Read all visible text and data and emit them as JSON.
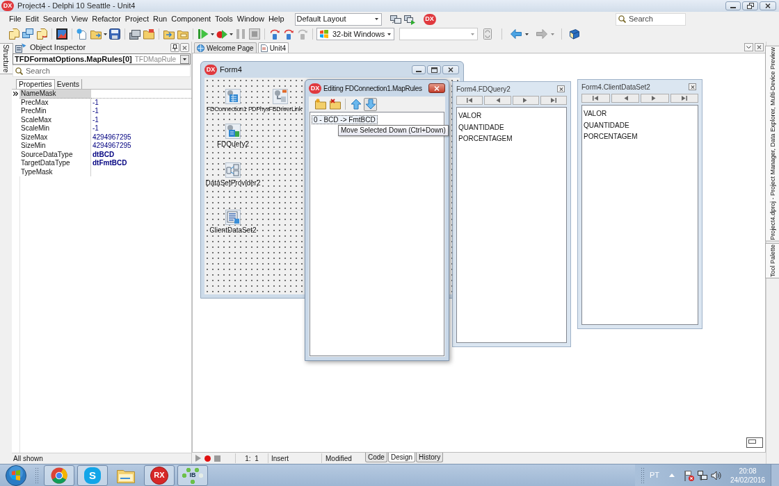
{
  "window": {
    "logo": "DX",
    "title": "Project4 - Delphi 10 Seattle - Unit4"
  },
  "menu_bar": {
    "items": [
      "File",
      "Edit",
      "Search",
      "View",
      "Refactor",
      "Project",
      "Run",
      "Component",
      "Tools",
      "Window",
      "Help"
    ],
    "layout_combo": "Default Layout",
    "logo": "DX",
    "search": {
      "placeholder": "Search"
    }
  },
  "toolbar": {
    "platform_combo": "32-bit Windows"
  },
  "left_dock": {
    "tabs": [
      "Structure"
    ]
  },
  "object_inspector": {
    "title": "Object Inspector",
    "object": {
      "name": "TFDFormatOptions.MapRules[0]",
      "type": "TFDMapRule"
    },
    "search": {
      "placeholder": "Search"
    },
    "tabs": [
      {
        "label": "Properties",
        "selected": true
      },
      {
        "label": "Events",
        "selected": false
      }
    ],
    "properties": [
      {
        "name": "NameMask",
        "selected": true
      },
      {
        "name": "PrecMax",
        "value": "-1",
        "selected": false,
        "modified": false
      },
      {
        "name": "PrecMin",
        "value": "-1",
        "selected": false,
        "modified": false
      },
      {
        "name": "ScaleMax",
        "value": "-1",
        "selected": false,
        "modified": false
      },
      {
        "name": "ScaleMin",
        "value": "-1",
        "selected": false,
        "modified": false
      },
      {
        "name": "SizeMax",
        "value": "4294967295",
        "selected": false,
        "modified": false
      },
      {
        "name": "SizeMin",
        "value": "4294967295",
        "selected": false,
        "modified": false
      },
      {
        "name": "SourceDataType",
        "value": "dtBCD",
        "selected": false,
        "modified": true
      },
      {
        "name": "TargetDataType",
        "value": "dtFmtBCD",
        "selected": false,
        "modified": true
      },
      {
        "name": "TypeMask",
        "selected": false
      }
    ],
    "status": "All shown"
  },
  "editor": {
    "tabs": [
      {
        "label": "Welcome Page",
        "selected": false
      },
      {
        "label": "Unit4",
        "selected": true
      }
    ],
    "form": {
      "logo": "DX",
      "title": "Form4",
      "components": [
        {
          "label": "FDConnection1",
          "kind": "connection"
        },
        {
          "label": "FDPhysFBDriverLink",
          "kind": "driver_link"
        },
        {
          "label": "FDQuery2",
          "kind": "query"
        },
        {
          "label": "DataSetProvider2",
          "kind": "provider"
        },
        {
          "label": "ClientDataSet2",
          "kind": "client_dataset"
        }
      ]
    },
    "map_rules_editor": {
      "logo": "DX",
      "title": "Editing FDConnection1.MapRules",
      "tools": [
        {
          "kind": "add",
          "hot": false
        },
        {
          "kind": "delete",
          "hot": false
        },
        {
          "kind": "move_up",
          "hot": false
        },
        {
          "kind": "move_down",
          "hot": true
        }
      ],
      "items": [
        {
          "label": "0 - BCD -> FmtBCD",
          "selected": true
        }
      ],
      "tooltip": "Move Selected Down (Ctrl+Down)"
    },
    "dataset_panels": [
      {
        "title": "Form4.FDQuery2",
        "fields": [
          "VALOR",
          "QUANTIDADE",
          "PORCENTAGEM"
        ]
      },
      {
        "title": "Form4.ClientDataSet2",
        "fields": [
          "VALOR",
          "QUANTIDADE",
          "PORCENTAGEM"
        ]
      }
    ],
    "status_bar": {
      "position": "1:  1",
      "mode": "Insert",
      "state": "Modified",
      "tabs": [
        {
          "label": "Code",
          "selected": false
        },
        {
          "label": "Design",
          "selected": true
        },
        {
          "label": "History",
          "selected": false
        }
      ]
    }
  },
  "right_dock": {
    "tabs": [
      "Project4.dproj - Project Manager, Data Explorer, Multi-Device Preview",
      "Tool Palette"
    ]
  },
  "taskbar": {
    "apps": [
      {
        "kind": "browser",
        "running": true
      },
      {
        "kind": "messenger",
        "label": "S",
        "running": true
      },
      {
        "kind": "folder",
        "running": false
      },
      {
        "kind": "badge",
        "label": "RX",
        "running": true
      },
      {
        "kind": "nodes",
        "label": "IB",
        "running": true
      }
    ],
    "language": "PT",
    "time": "20:08",
    "date": "24/02/2016"
  }
}
